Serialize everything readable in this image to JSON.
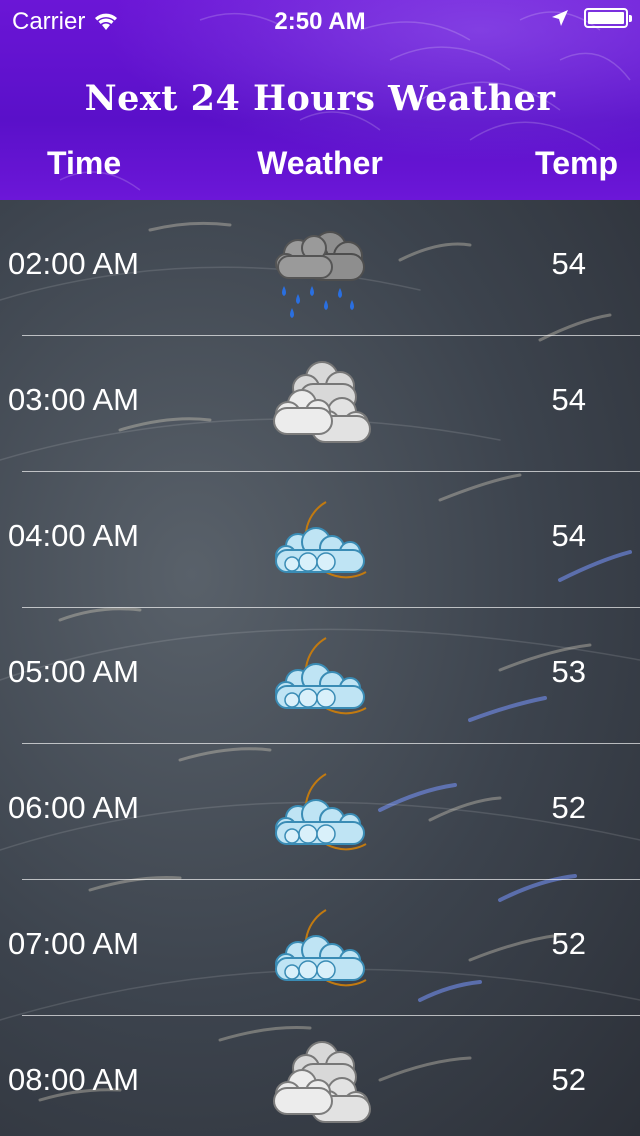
{
  "status_bar": {
    "carrier": "Carrier",
    "time": "2:50 AM",
    "battery_level": 1.0,
    "icons": [
      "wifi-icon",
      "location-arrow-icon",
      "battery-icon"
    ]
  },
  "header": {
    "title": "Next 24 Hours Weather",
    "columns": {
      "time": "Time",
      "weather": "Weather",
      "temp": "Temp"
    }
  },
  "colors": {
    "header_purple": "#5a10c9",
    "text": "#ffffff",
    "separator": "#ffffff"
  },
  "hours": [
    {
      "time": "02:00 AM",
      "icon": "rain-cloud-icon",
      "temp": "54"
    },
    {
      "time": "03:00 AM",
      "icon": "cloudy-icon",
      "temp": "54"
    },
    {
      "time": "04:00 AM",
      "icon": "night-cloudy-icon",
      "temp": "54"
    },
    {
      "time": "05:00 AM",
      "icon": "night-cloudy-icon",
      "temp": "53"
    },
    {
      "time": "06:00 AM",
      "icon": "night-cloudy-icon",
      "temp": "52"
    },
    {
      "time": "07:00 AM",
      "icon": "night-cloudy-icon",
      "temp": "52"
    },
    {
      "time": "08:00 AM",
      "icon": "cloudy-icon",
      "temp": "52"
    }
  ]
}
